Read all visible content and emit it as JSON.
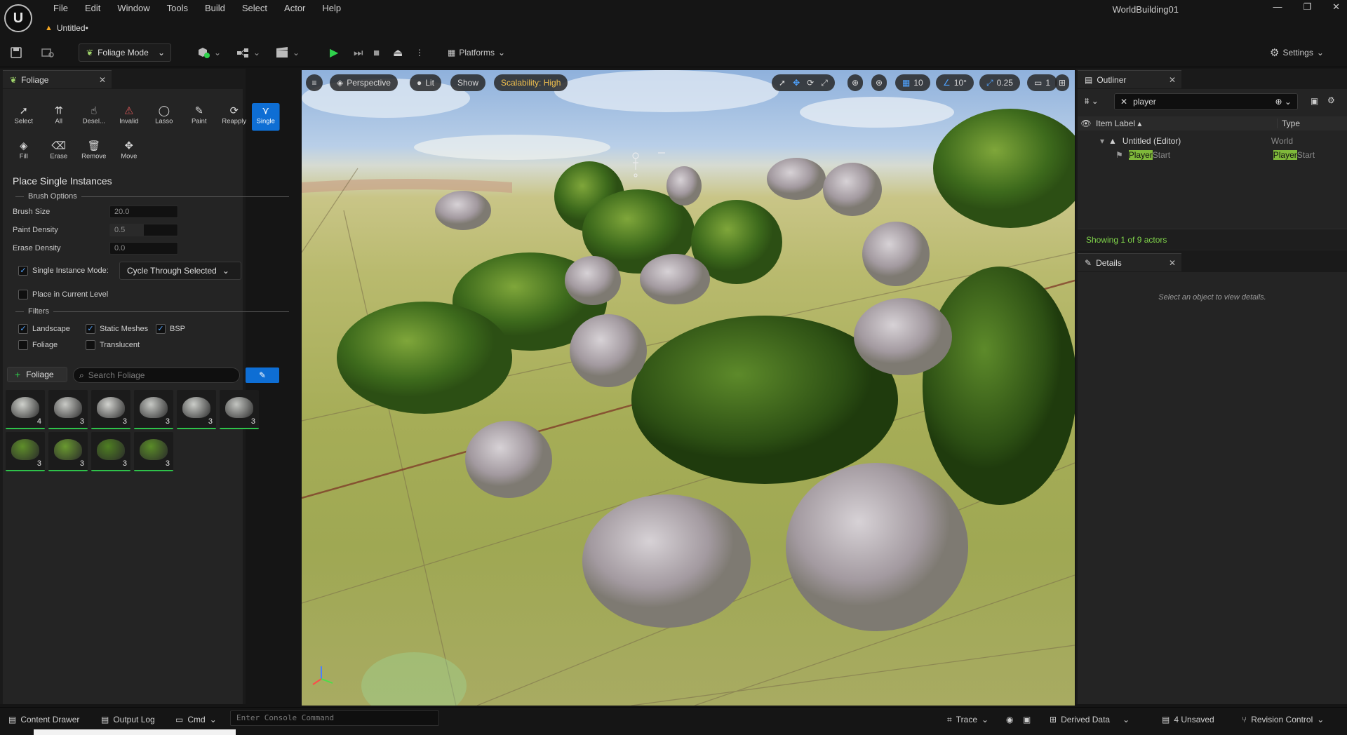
{
  "app": {
    "logo": "U",
    "menu": [
      "File",
      "Edit",
      "Window",
      "Tools",
      "Build",
      "Select",
      "Actor",
      "Help"
    ],
    "doc_tab": "Untitled•",
    "window_title": "WorldBuilding01",
    "window_controls": [
      "—",
      "❐",
      "✕"
    ]
  },
  "toolbar": {
    "mode": "Foliage Mode",
    "platforms": "Platforms",
    "settings": "Settings"
  },
  "foliage_panel": {
    "tab": "Foliage",
    "tools": [
      {
        "label": "Select",
        "icon": "cursor-icon"
      },
      {
        "label": "All",
        "icon": "select-all-icon"
      },
      {
        "label": "Desel...",
        "icon": "deselect-icon"
      },
      {
        "label": "Invalid",
        "icon": "select-invalid-icon"
      },
      {
        "label": "Lasso",
        "icon": "lasso-icon"
      },
      {
        "label": "Paint",
        "icon": "paint-brush-icon"
      },
      {
        "label": "Reapply",
        "icon": "reapply-icon"
      },
      {
        "label": "Single",
        "icon": "single-foliage-icon"
      },
      {
        "label": "Fill",
        "icon": "fill-bucket-icon"
      },
      {
        "label": "Erase",
        "icon": "erase-icon"
      },
      {
        "label": "Remove",
        "icon": "trash-icon"
      },
      {
        "label": "Move",
        "icon": "move-icon"
      }
    ],
    "active_tool": "Single",
    "section_title": "Place Single Instances",
    "brush_options_header": "Brush Options",
    "brush_size_label": "Brush Size",
    "brush_size_value": "20.0",
    "paint_density_label": "Paint Density",
    "paint_density_value": "0.5",
    "paint_density_fill": 0.5,
    "erase_density_label": "Erase Density",
    "erase_density_value": "0.0",
    "single_instance_mode_label": "Single Instance Mode:",
    "single_instance_mode_checked": true,
    "single_instance_mode_value": "Cycle Through Selected",
    "place_current_level_label": "Place in Current Level",
    "place_current_level_checked": false,
    "filters_header": "Filters",
    "filters": [
      {
        "label": "Landscape",
        "checked": true
      },
      {
        "label": "Static Meshes",
        "checked": true
      },
      {
        "label": "BSP",
        "checked": true
      },
      {
        "label": "Foliage",
        "checked": false
      },
      {
        "label": "Translucent",
        "checked": false
      }
    ],
    "add_foliage_label": "Foliage",
    "search_placeholder": "Search Foliage",
    "foliage_items": [
      {
        "count": "4",
        "color": "#cfd1cc"
      },
      {
        "count": "3",
        "color": "#c9cac6"
      },
      {
        "count": "3",
        "color": "#d2d3cf"
      },
      {
        "count": "3",
        "color": "#c6c8c4"
      },
      {
        "count": "3",
        "color": "#cbcdc9"
      },
      {
        "count": "3",
        "color": "#c3c5c1"
      },
      {
        "count": "3",
        "color": "#5f8f2a"
      },
      {
        "count": "3",
        "color": "#6a9a30"
      },
      {
        "count": "3",
        "color": "#4f7f22"
      },
      {
        "count": "3",
        "color": "#5a8c28"
      }
    ]
  },
  "viewport": {
    "perspective": "Perspective",
    "lit": "Lit",
    "show": "Show",
    "scalability": "Scalability: High",
    "grid_snap": "10",
    "rotation_snap": "10°",
    "scale_snap": "0.25",
    "camera_speed": "1"
  },
  "outliner": {
    "tab": "Outliner",
    "search_value": "player",
    "col_label": "Item Label",
    "col_type": "Type",
    "rows": [
      {
        "label": "Untitled (Editor)",
        "type": "World"
      },
      {
        "label_highlight": "Player",
        "label_rest": "Start",
        "type_highlight": "Player",
        "type_rest": "Start"
      }
    ],
    "status": "Showing 1 of 9 actors"
  },
  "details": {
    "tab": "Details",
    "empty_message": "Select an object to view details."
  },
  "statusbar": {
    "content_drawer": "Content Drawer",
    "output_log": "Output Log",
    "cmd": "Cmd",
    "console_placeholder": "Enter Console Command",
    "trace": "Trace",
    "derived_data": "Derived Data",
    "unsaved": "4 Unsaved",
    "revision_control": "Revision Control"
  },
  "colors": {
    "accent_blue": "#0e6ed4",
    "play_green": "#2fd14c",
    "scalability_yellow": "#f2c14e",
    "status_green": "#7fd34a",
    "highlight_green": "#7fb83a"
  }
}
